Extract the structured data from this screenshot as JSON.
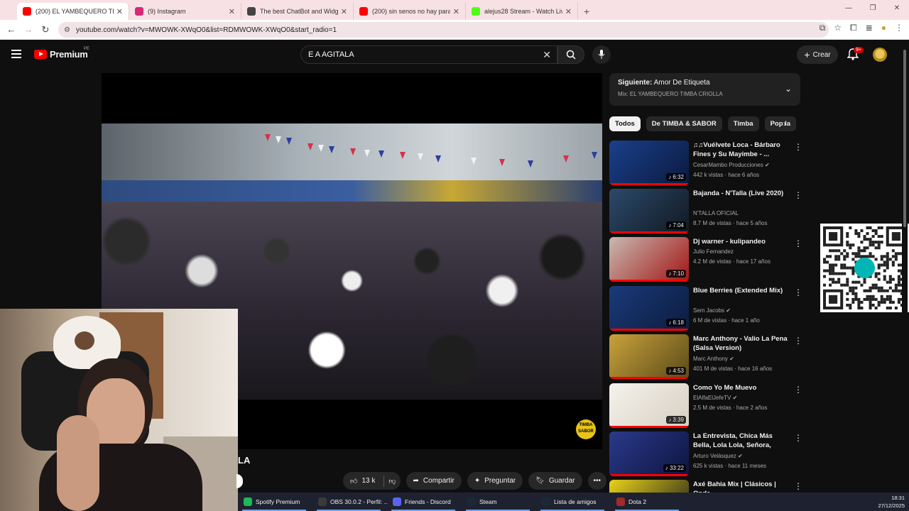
{
  "browser": {
    "tabs": [
      {
        "title": "(200) EL YAMBEQUERO TIMBA",
        "color": "#ff0000"
      },
      {
        "title": "(9) Instagram",
        "color": "#d62976"
      },
      {
        "title": "The best ChatBot and Widgets",
        "color": "#444444"
      },
      {
        "title": "(200) sin senos no hay paraiso",
        "color": "#ff0000"
      },
      {
        "title": "alejus28 Stream - Watch Live on",
        "color": "#53fc18"
      }
    ],
    "url": "youtube.com/watch?v=MWOWK-XWqO0&list=RDMWOWK-XWqO0&start_radio=1"
  },
  "header": {
    "logo_text": "Premium",
    "country": "PE",
    "search_value": "E A AGITALA",
    "create_label": "Crear",
    "notif_count": "9+"
  },
  "video": {
    "title_fragment": "LA",
    "watermark": "TIMBA SABOR",
    "like_count": "13 k",
    "share_label": "Compartir",
    "ask_label": "Preguntar",
    "save_label": "Guardar"
  },
  "playlist": {
    "next_prefix": "Siguiente:",
    "next_title": "Amor De Etiqueta",
    "mix_name": "Mix: EL YAMBEQUERO TIMBA CRIOLLA"
  },
  "chips": [
    "Todos",
    "De TIMBA & SABOR",
    "Timba",
    "Pop la"
  ],
  "recommendations": [
    {
      "title": "♫♫Vuélvete Loca - Bárbaro Fines y Su Mayimbe - ...",
      "channel": "CesarMambo Producciones",
      "verified": true,
      "meta": "442 k vistas · hace 6 años",
      "duration": "6:32",
      "c1": "#1b3f8a",
      "c2": "#0a1a40"
    },
    {
      "title": "Bajanda -  N'Talla (Live 2020)",
      "channel": "N'TALLA OFICIAL",
      "verified": false,
      "meta": "8.7 M de vistas · hace 5 años",
      "duration": "7:04",
      "c1": "#2b4a6a",
      "c2": "#111822"
    },
    {
      "title": "Dj warner - kulipandeo",
      "channel": "Julio Fernandez",
      "verified": false,
      "meta": "4.2 M de vistas · hace 17 años",
      "duration": "7:10",
      "c1": "#c8b9b0",
      "c2": "#a31515"
    },
    {
      "title": "Blue Berries (Extended Mix)",
      "channel": "Sem Jacobs",
      "verified": true,
      "meta": "6 M de vistas · hace 1 año",
      "duration": "6:18",
      "c1": "#1a3a7a",
      "c2": "#0c1c3e"
    },
    {
      "title": "Marc Anthony - Valio La Pena (Salsa Version)",
      "channel": "Marc Anthony",
      "verified": true,
      "meta": "401 M de vistas · hace 16 años",
      "duration": "4:53",
      "c1": "#c9a23a",
      "c2": "#5a4a1a"
    },
    {
      "title": "Como Yo Me Muevo",
      "channel": "ElAlfaElJefeTV",
      "verified": true,
      "meta": "2.5 M de vistas · hace 2 años",
      "duration": "3:39",
      "c1": "#f4f2ec",
      "c2": "#d8d0c2"
    },
    {
      "title": "La Entrevista, Chica Más Bella, Lola Lola, Señora, Juana ...",
      "channel": "Arturo Velásquez",
      "verified": true,
      "meta": "625 k vistas · hace 11 meses",
      "duration": "33:22",
      "c1": "#2a3a8a",
      "c2": "#0e1440"
    },
    {
      "title": "Axé Bahia Mix | Clásicos | Onda",
      "channel": "",
      "verified": false,
      "meta": "",
      "duration": "",
      "c1": "#e9d21a",
      "c2": "#1a1a1a"
    }
  ],
  "taskbar": [
    {
      "label": "Spotify Premium",
      "color": "#1db954"
    },
    {
      "label": "OBS 30.0.2 - Perfil: ...",
      "color": "#3a3a3a"
    },
    {
      "label": "Friends - Discord",
      "color": "#5865f2"
    },
    {
      "label": "Steam",
      "color": "#1b2838"
    },
    {
      "label": "Lista de amigos",
      "color": "#1b2838"
    },
    {
      "label": "Dota 2",
      "color": "#a52a2a"
    }
  ],
  "clock": {
    "time": "18:31",
    "date": "27/12/2025"
  },
  "qr_label": "yape"
}
